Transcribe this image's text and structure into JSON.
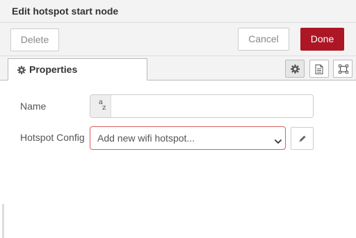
{
  "tray": {
    "title": "Edit hotspot start node"
  },
  "toolbar": {
    "delete_label": "Delete",
    "cancel_label": "Cancel",
    "done_label": "Done",
    "done_color": "#ad1625"
  },
  "tabs": [
    {
      "label": "Properties",
      "icon": "gear-icon",
      "active": true
    }
  ],
  "tab_icons": [
    "gear-icon",
    "document-icon",
    "frame-icon"
  ],
  "form": {
    "name": {
      "label": "Name",
      "value": "",
      "type_icon_text": {
        "upper": "a",
        "lower": "z"
      }
    },
    "hotspot_config": {
      "label": "Hotspot Config",
      "selected": "Add new wifi hotspot...",
      "error_border_color": "#d6615e",
      "edit_icon": "pencil-icon"
    }
  }
}
